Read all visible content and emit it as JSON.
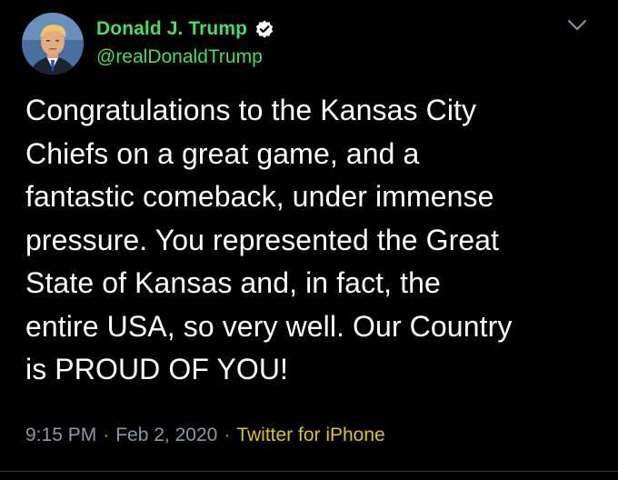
{
  "author": {
    "display_name": "Donald J. Trump",
    "handle": "@realDonaldTrump",
    "verified": true
  },
  "tweet": {
    "text": "Congratulations to the Kansas City\nChiefs on a great game, and a\nfantastic comeback, under immense\npressure. You represented the Great\nState of Kansas and, in fact, the\nentire USA, so very well. Our Country\nis PROUD OF YOU!",
    "time": "9:15 PM",
    "date": "Feb 2, 2020",
    "separator": "·",
    "source": "Twitter for iPhone"
  },
  "icons": {
    "verified": "verified-badge-icon",
    "menu": "chevron-down-icon"
  },
  "colors": {
    "background": "#000000",
    "name": "#4cd964",
    "text": "#ffffff",
    "meta": "#8899a6",
    "source": "#d4c42a"
  }
}
